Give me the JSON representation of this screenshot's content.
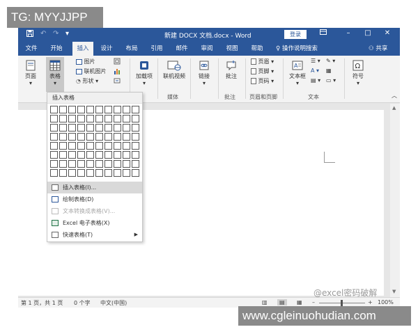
{
  "watermarks": {
    "top_left": "TG: MYYJJPP",
    "bottom_right": "www.cgleinuohudian.com",
    "overlay": "@excel密码破解"
  },
  "titlebar": {
    "title": "新建 DOCX 文档.docx  -  Word",
    "login": "登录",
    "save_icon": "save-icon",
    "undo_icon": "undo-icon",
    "redo_icon": "redo-icon"
  },
  "tabs": [
    {
      "label": "文件"
    },
    {
      "label": "开始"
    },
    {
      "label": "插入",
      "active": true
    },
    {
      "label": "设计"
    },
    {
      "label": "布局"
    },
    {
      "label": "引用"
    },
    {
      "label": "邮件"
    },
    {
      "label": "审阅"
    },
    {
      "label": "视图"
    },
    {
      "label": "帮助"
    }
  ],
  "tell_me": "操作说明搜索",
  "share": "共享",
  "ribbon": {
    "page_label": "页面",
    "table_label": "表格",
    "picture_label": "图片",
    "online_picture_label": "联机图片",
    "shapes_label": "形状",
    "addins_label": "加载项",
    "online_video_label": "联机视频",
    "media_group": "媒体",
    "link_label": "链接",
    "comment_label": "批注",
    "comment_group": "批注",
    "header_label": "页眉",
    "footer_label": "页脚",
    "page_number_label": "页码",
    "header_footer_group": "页眉和页脚",
    "textbox_label": "文本框",
    "text_group": "文本",
    "symbol_label": "符号"
  },
  "dropdown": {
    "header": "插入表格",
    "items": [
      {
        "label": "插入表格(I)...",
        "icon": "table-icon",
        "hover": true
      },
      {
        "label": "绘制表格(D)",
        "icon": "pencil-icon"
      },
      {
        "label": "文本转换成表格(V)...",
        "icon": "convert-icon",
        "disabled": true
      },
      {
        "label": "Excel 电子表格(X)",
        "icon": "excel-icon"
      },
      {
        "label": "快速表格(T)",
        "icon": "quick-table-icon",
        "submenu": true
      }
    ]
  },
  "statusbar": {
    "page": "第 1 页，共 1 页",
    "words": "0 个字",
    "language": "中文(中国)",
    "zoom": "100%"
  },
  "colors": {
    "accent": "#2b579a",
    "ribbon_bg": "#f3f3f3",
    "workspace": "#e6e6e6"
  }
}
